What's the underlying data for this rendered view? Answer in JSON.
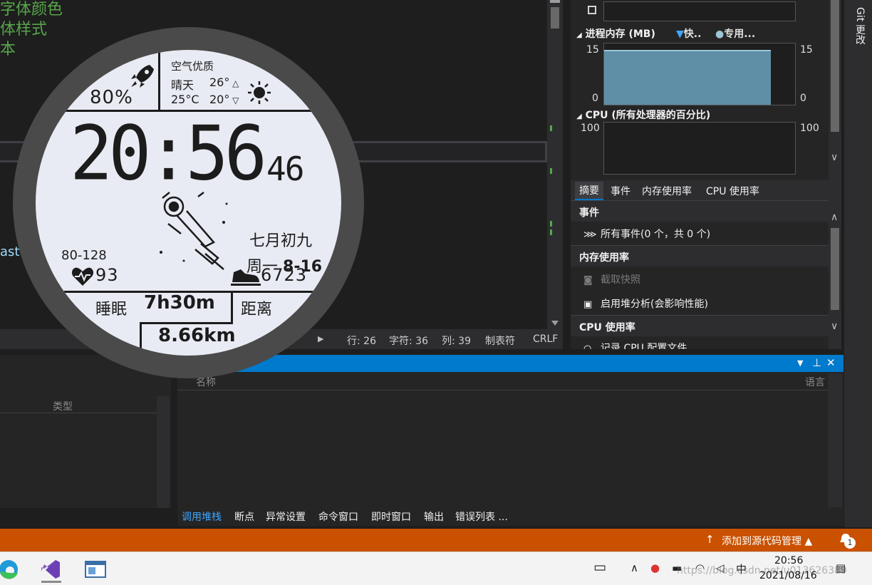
{
  "editor": {
    "lines": [
      "字体颜色",
      "体样式",
      "本"
    ],
    "identifier_fragment": "ast"
  },
  "status_row": {
    "line": "行: 26",
    "char": "字符: 36",
    "col": "列: 39",
    "tabs": "制表符",
    "eol": "CRLF"
  },
  "diagnostics": {
    "memory": {
      "title": "进程内存 (MB)",
      "legend_snapshot": "快..",
      "legend_private": "专用...",
      "y_max": "15",
      "y_min": "0",
      "level": 0.92
    },
    "cpu": {
      "title": "CPU (所有处理器的百分比)",
      "y_max": "100",
      "y_min": "0"
    },
    "tabs": [
      "摘要",
      "事件",
      "内存使用率",
      "CPU 使用率"
    ],
    "events": {
      "header": "事件",
      "all_events": "所有事件(0 个，共 0 个)"
    },
    "memory_usage": {
      "header": "内存使用率",
      "snapshot": "截取快照",
      "heap_analysis": "启用堆分析(会影响性能)"
    },
    "cpu_usage": {
      "header": "CPU 使用率",
      "record": "记录 CPU 配置文件"
    }
  },
  "git_changes": "Git 更改",
  "left_panel": {
    "type_col": "类型"
  },
  "call_stack": {
    "col_name": "名称",
    "col_lang": "语言",
    "tabs": [
      "调用堆栈",
      "断点",
      "异常设置",
      "命令窗口",
      "即时窗口",
      "输出",
      "错误列表 ..."
    ],
    "active_tab": 0
  },
  "vs_status": {
    "source_control": "添加到源代码管理",
    "notifications": "1"
  },
  "taskbar": {
    "ime": "中",
    "time": "20:56",
    "date": "2021/08/16",
    "watermark": "https://blog.csdn.net/u013626389"
  },
  "watch": {
    "battery": "80%",
    "air_quality": "空气优质",
    "weather": "晴天",
    "temp_now": "25°C",
    "temp_high": "26°",
    "temp_low": "20°",
    "time_hm": "20:56",
    "time_sec": "46",
    "lunar_date": "七月初九",
    "weekday": "周一",
    "date": "8-16",
    "heart_range": "80-128",
    "heart_rate": "93",
    "steps": "6723",
    "sleep_label": "睡眠",
    "sleep_value": "7h30m",
    "distance_label": "距离",
    "distance_value": "8.66km"
  }
}
